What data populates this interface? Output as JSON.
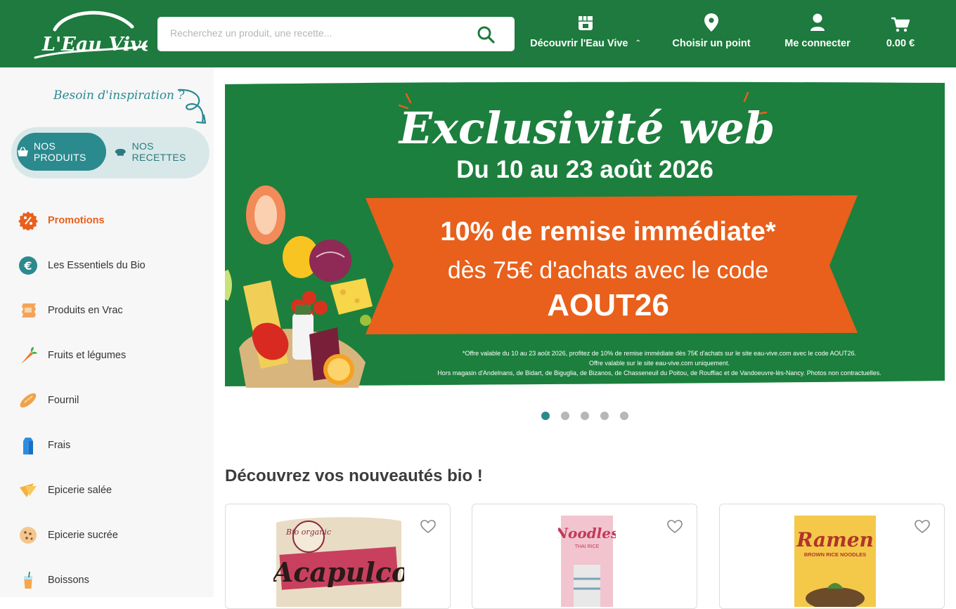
{
  "header": {
    "logo_text": "L'Eau Vive",
    "search_placeholder": "Recherchez un produit, une recette...",
    "nav": {
      "decouvrir": "Découvrir l'Eau Vive",
      "point": "Choisir un point",
      "connect": "Me connecter",
      "cart_total": "0.00 €"
    }
  },
  "sidebar": {
    "inspiration": "Besoin d'inspiration ?",
    "toggle": {
      "products": "NOS PRODUITS",
      "recipes": "NOS RECETTES"
    },
    "categories": [
      {
        "label": "Promotions",
        "icon": "percent-badge-icon"
      },
      {
        "label": "Les Essentiels du Bio",
        "icon": "euro-icon"
      },
      {
        "label": "Produits en Vrac",
        "icon": "bulk-bag-icon"
      },
      {
        "label": "Fruits et légumes",
        "icon": "carrot-icon"
      },
      {
        "label": "Fournil",
        "icon": "bread-icon"
      },
      {
        "label": "Frais",
        "icon": "milk-carton-icon"
      },
      {
        "label": "Epicerie salée",
        "icon": "chips-icon"
      },
      {
        "label": "Epicerie sucrée",
        "icon": "cookie-icon"
      },
      {
        "label": "Boissons",
        "icon": "drink-icon"
      }
    ]
  },
  "banner": {
    "title": "Exclusivité web",
    "dates": "Du 10 au 23 août 2026",
    "offer_line1": "10% de remise immédiate*",
    "offer_line2": "dès 75€ d'achats avec le code",
    "code": "AOUT26",
    "fine1": "*Offre valable du 10 au 23  août 2026, profitez de 10% de remise immédiate dès 75€ d'achats sur le site eau-vive.com avec le code AOUT26.",
    "fine2": "Offre valable sur le site eau-vive.com uniquement.",
    "fine3": "Hors magasin d'Andelnans, de Bidart, de Biguglia, de Bizanos, de Chasseneuil du Poitou, de Rouffiac et de Vandoeuvre-lès-Nancy. Photos non contractuelles.",
    "slides_count": 5,
    "active_slide": 1
  },
  "main": {
    "section_title": "Découvrez vos nouveautés bio !",
    "products": [
      {
        "brand": "Bio organic",
        "name": "Acapulco"
      },
      {
        "brand": "",
        "name": "Noodles",
        "sub": "THAI RICE"
      },
      {
        "brand": "",
        "name": "Ramen",
        "sub": "BROWN RICE NOODLES"
      }
    ]
  },
  "colors": {
    "header_green": "#1e7a3e",
    "teal": "#2a8a8e",
    "promo_orange": "#e8601b",
    "banner_green": "#1c7f3d"
  }
}
